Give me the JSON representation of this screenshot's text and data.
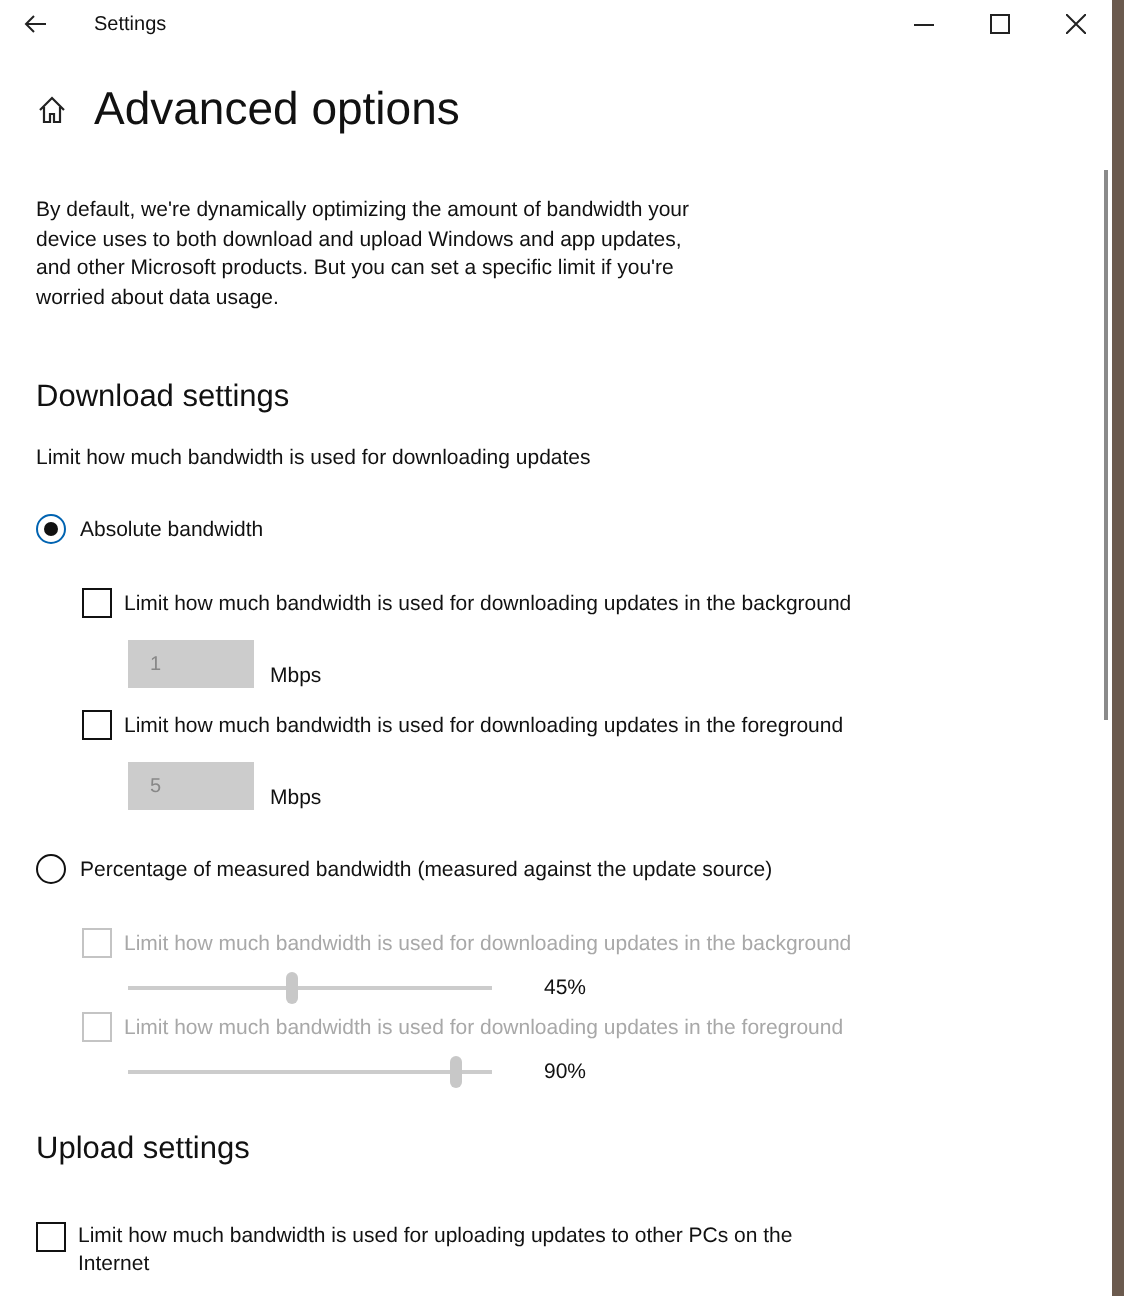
{
  "window": {
    "title": "Settings"
  },
  "page": {
    "title": "Advanced options",
    "intro": "By default, we're dynamically optimizing the amount of bandwidth your device uses to both download and upload Windows and app updates, and other Microsoft products. But you can set a specific limit if you're worried about data usage."
  },
  "download_settings": {
    "heading": "Download settings",
    "description": "Limit how much bandwidth is used for downloading updates",
    "options": [
      {
        "label": "Absolute bandwidth",
        "selected": true,
        "items": [
          {
            "kind": "number",
            "label": "Limit how much bandwidth is used for downloading updates in the background",
            "checked": false,
            "disabled": false,
            "value": "1",
            "field_disabled": true,
            "unit": "Mbps"
          },
          {
            "kind": "number",
            "label": "Limit how much bandwidth is used for downloading updates in the foreground",
            "checked": false,
            "disabled": false,
            "value": "5",
            "field_disabled": true,
            "unit": "Mbps"
          }
        ]
      },
      {
        "label": "Percentage of measured bandwidth (measured against the update source)",
        "selected": false,
        "items": [
          {
            "kind": "slider",
            "label": "Limit how much bandwidth is used for downloading updates in the background",
            "checked": false,
            "disabled": true,
            "level": 0.45,
            "reading": "45%"
          },
          {
            "kind": "slider",
            "label": "Limit how much bandwidth is used for downloading updates in the foreground",
            "checked": false,
            "disabled": true,
            "level": 0.9,
            "reading": "90%"
          }
        ]
      }
    ]
  },
  "upload_settings": {
    "heading": "Upload settings",
    "options": [
      {
        "label": "Limit how much bandwidth is used for uploading updates to other PCs on the Internet",
        "checked": false
      }
    ]
  }
}
